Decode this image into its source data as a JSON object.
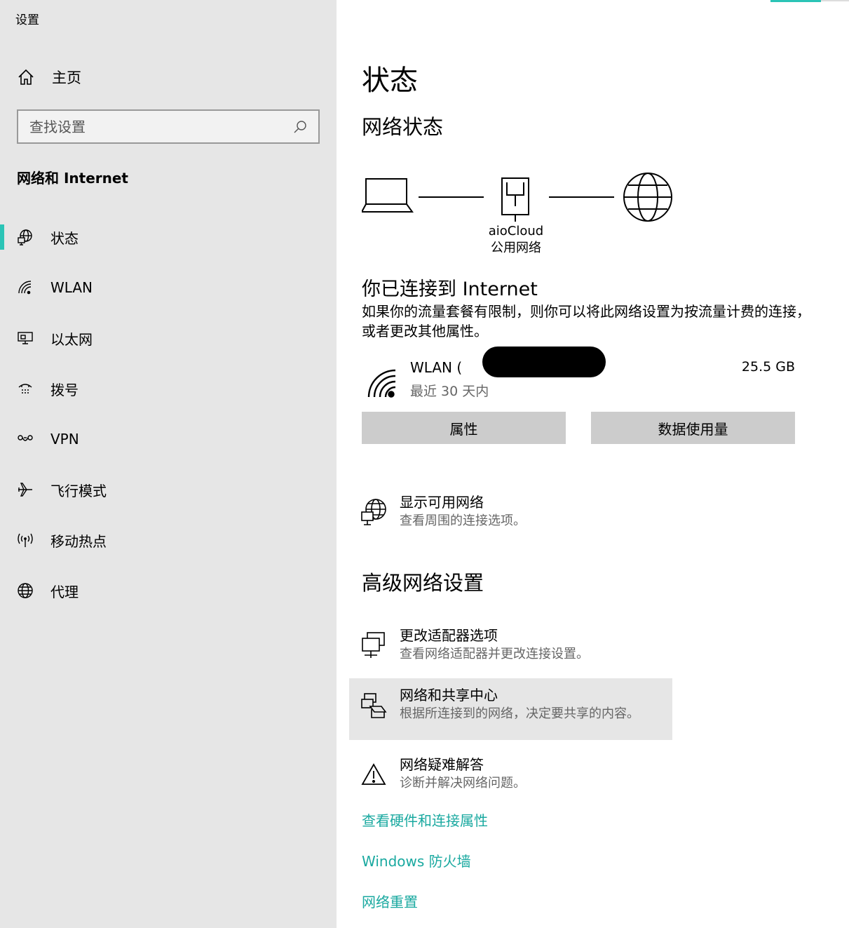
{
  "window": {
    "title": "设置"
  },
  "sidebar": {
    "home_label": "主页",
    "search_placeholder": "查找设置",
    "section_title": "网络和 Internet",
    "items": [
      {
        "label": "状态",
        "icon": "globe-status-icon",
        "active": true
      },
      {
        "label": "WLAN",
        "icon": "wifi-icon"
      },
      {
        "label": "以太网",
        "icon": "ethernet-icon"
      },
      {
        "label": "拨号",
        "icon": "dialup-icon"
      },
      {
        "label": "VPN",
        "icon": "vpn-icon"
      },
      {
        "label": "飞行模式",
        "icon": "airplane-icon"
      },
      {
        "label": "移动热点",
        "icon": "hotspot-icon"
      },
      {
        "label": "代理",
        "icon": "globe-icon"
      }
    ]
  },
  "main": {
    "title": "状态",
    "network_status_heading": "网络状态",
    "diagram": {
      "network_name": "aioCloud",
      "network_type": "公用网络"
    },
    "connected_title": "你已连接到 Internet",
    "connected_desc": "如果你的流量套餐有限制，则你可以将此网络设置为按流量计费的连接，或者更改其他属性。",
    "wlan": {
      "name": "WLAN (",
      "period": "最近 30 天内",
      "amount": "25.5 GB"
    },
    "buttons": {
      "properties": "属性",
      "data_usage": "数据使用量"
    },
    "show_networks": {
      "title": "显示可用网络",
      "desc": "查看周围的连接选项。"
    },
    "advanced_heading": "高级网络设置",
    "advanced_items": [
      {
        "title": "更改适配器选项",
        "desc": "查看网络适配器并更改连接设置。"
      },
      {
        "title": "网络和共享中心",
        "desc": "根据所连接到的网络，决定要共享的内容。"
      },
      {
        "title": "网络疑难解答",
        "desc": "诊断并解决网络问题。"
      }
    ],
    "links": {
      "hardware": "查看硬件和连接属性",
      "firewall": "Windows 防火墙",
      "reset": "网络重置"
    }
  },
  "colors": {
    "accent": "#2bc4b6",
    "link": "#1aa9a0",
    "sidebar_bg": "#e6e6e6",
    "button_bg": "#cccccc"
  }
}
